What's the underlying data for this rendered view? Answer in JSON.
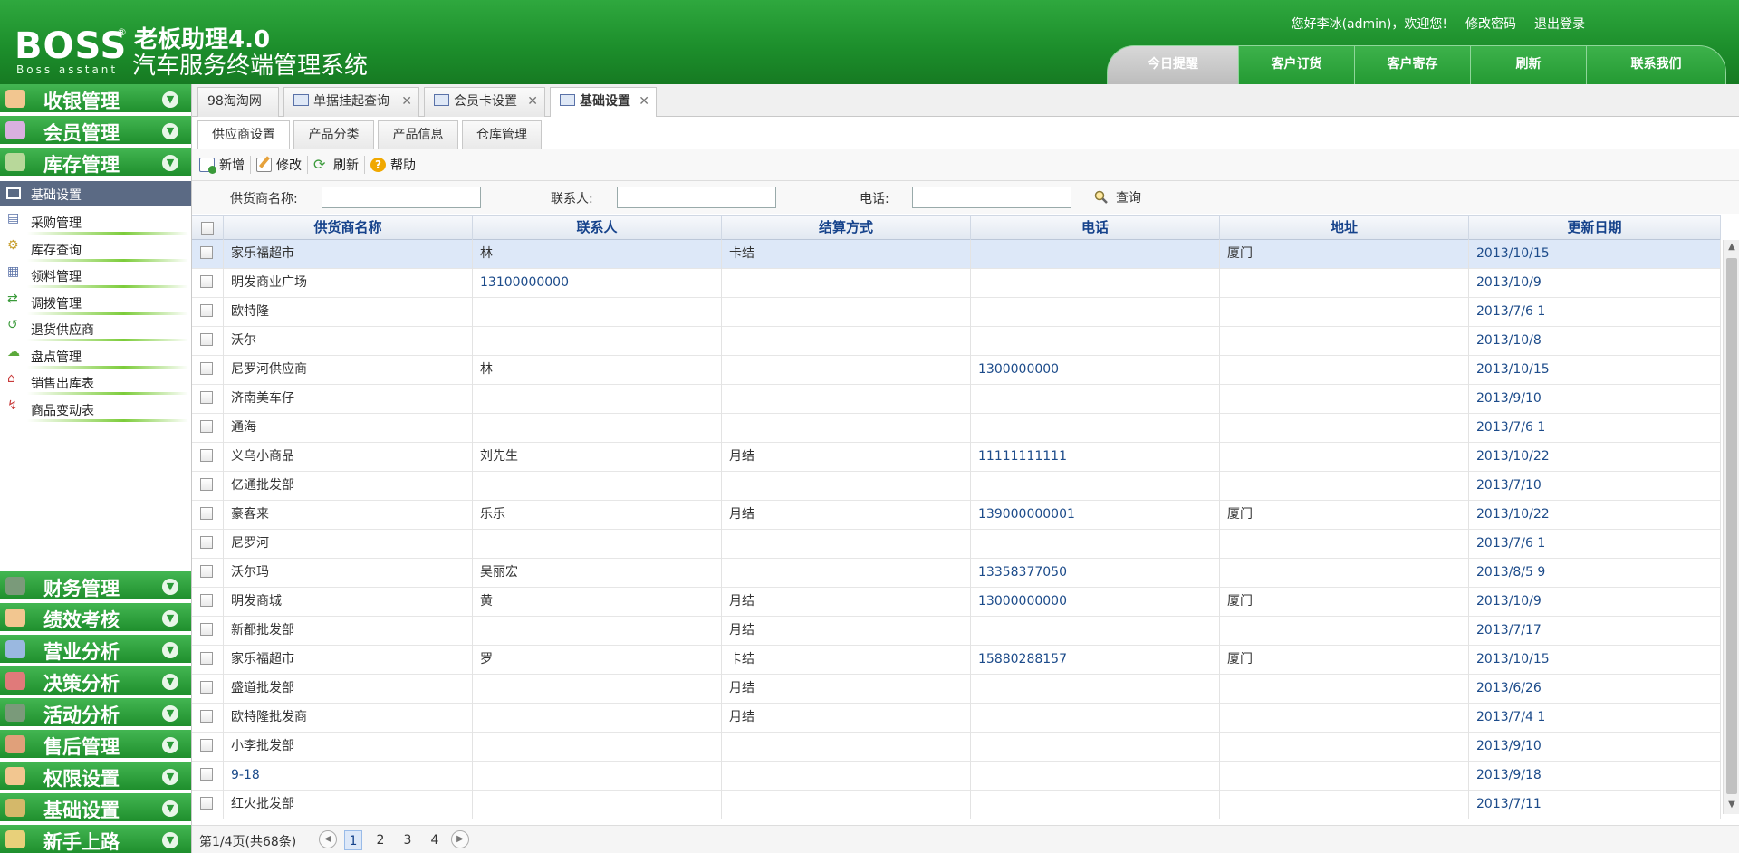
{
  "header": {
    "logo_text": "BOSS",
    "logo_reg": "®",
    "logo_sub": "Boss asstant",
    "title_line1": "老板助理4.0",
    "title_line2": "汽车服务终端管理系统",
    "greeting": "您好李冰(admin)，欢迎您!",
    "change_password": "修改密码",
    "logout": "退出登录",
    "nav": [
      "今日提醒",
      "客户订货",
      "客户寄存",
      "刷新",
      "联系我们"
    ]
  },
  "sidebar": {
    "top_menus": [
      {
        "label": "收银管理",
        "icon": "cashier-icon"
      },
      {
        "label": "会员管理",
        "icon": "member-icon"
      },
      {
        "label": "库存管理",
        "icon": "inventory-icon"
      }
    ],
    "active_sub": "基础设置",
    "sub_items": [
      {
        "label": "采购管理",
        "icon": "purchase-icon",
        "glyph": "▤"
      },
      {
        "label": "库存查询",
        "icon": "inventory-query-icon",
        "glyph": "⚙"
      },
      {
        "label": "领料管理",
        "icon": "requisition-icon",
        "glyph": "▦"
      },
      {
        "label": "调拨管理",
        "icon": "transfer-icon",
        "glyph": "⇄"
      },
      {
        "label": "退货供应商",
        "icon": "return-icon",
        "glyph": "↺"
      },
      {
        "label": "盘点管理",
        "icon": "stocktake-icon",
        "glyph": "☁"
      },
      {
        "label": "销售出库表",
        "icon": "sales-out-icon",
        "glyph": "⌂"
      },
      {
        "label": "商品变动表",
        "icon": "product-change-icon",
        "glyph": "↯"
      }
    ],
    "bottom_menus": [
      {
        "label": "财务管理",
        "icon": "finance-icon"
      },
      {
        "label": "绩效考核",
        "icon": "performance-icon"
      },
      {
        "label": "营业分析",
        "icon": "business-analysis-icon"
      },
      {
        "label": "决策分析",
        "icon": "decision-analysis-icon"
      },
      {
        "label": "活动分析",
        "icon": "activity-analysis-icon"
      },
      {
        "label": "售后管理",
        "icon": "after-sales-icon"
      },
      {
        "label": "权限设置",
        "icon": "permission-icon"
      },
      {
        "label": "基础设置",
        "icon": "basic-settings-icon"
      },
      {
        "label": "新手上路",
        "icon": "beginner-icon"
      }
    ]
  },
  "tabs": [
    {
      "label": "98淘淘网",
      "has_icon": false,
      "closable": false
    },
    {
      "label": "单据挂起查询",
      "has_icon": true,
      "closable": true
    },
    {
      "label": "会员卡设置",
      "has_icon": true,
      "closable": true
    },
    {
      "label": "基础设置",
      "has_icon": true,
      "closable": true,
      "active": true
    }
  ],
  "subtabs": [
    "供应商设置",
    "产品分类",
    "产品信息",
    "仓库管理"
  ],
  "toolbar": {
    "add": "新增",
    "edit": "修改",
    "refresh": "刷新",
    "help": "帮助"
  },
  "search": {
    "supplier_label": "供货商名称:",
    "contact_label": "联系人:",
    "phone_label": "电话:",
    "query": "查询",
    "supplier_value": "",
    "contact_value": "",
    "phone_value": ""
  },
  "grid": {
    "columns": [
      "供货商名称",
      "联系人",
      "结算方式",
      "电话",
      "地址",
      "更新日期"
    ],
    "rows": [
      [
        "家乐福超市",
        "林",
        "卡结",
        "",
        "厦门",
        "2013/10/15"
      ],
      [
        "明发商业广场",
        "13100000000",
        "",
        "",
        "",
        "2013/10/9"
      ],
      [
        "欧特隆",
        "",
        "",
        "",
        "",
        "2013/7/6 1"
      ],
      [
        "沃尔",
        "",
        "",
        "",
        "",
        "2013/10/8"
      ],
      [
        "尼罗河供应商",
        "林",
        "",
        "1300000000",
        "",
        "2013/10/15"
      ],
      [
        "济南美车仔",
        "",
        "",
        "",
        "",
        "2013/9/10"
      ],
      [
        "通海",
        "",
        "",
        "",
        "",
        "2013/7/6 1"
      ],
      [
        "义乌小商品",
        "刘先生",
        "月结",
        "11111111111",
        "",
        "2013/10/22"
      ],
      [
        "亿通批发部",
        "",
        "",
        "",
        "",
        "2013/7/10"
      ],
      [
        "豪客来",
        "乐乐",
        "月结",
        "139000000001",
        "厦门",
        "2013/10/22"
      ],
      [
        "尼罗河",
        "",
        "",
        "",
        "",
        "2013/7/6 1"
      ],
      [
        "沃尔玛",
        "吴丽宏",
        "",
        "13358377050",
        "",
        "2013/8/5 9"
      ],
      [
        "明发商城",
        "黄",
        "月结",
        "13000000000",
        "厦门",
        "2013/10/9"
      ],
      [
        "新都批发部",
        "",
        "月结",
        "",
        "",
        "2013/7/17"
      ],
      [
        "家乐福超市",
        "罗",
        "卡结",
        "15880288157",
        "厦门",
        "2013/10/15"
      ],
      [
        "盛道批发部",
        "",
        "月结",
        "",
        "",
        "2013/6/26"
      ],
      [
        "欧特隆批发商",
        "",
        "月结",
        "",
        "",
        "2013/7/4 1"
      ],
      [
        "小李批发部",
        "",
        "",
        "",
        "",
        "2013/9/10"
      ],
      [
        "9-18",
        "",
        "",
        "",
        "",
        "2013/9/18"
      ],
      [
        "红火批发部",
        "",
        "",
        "",
        "",
        "2013/7/11"
      ]
    ],
    "selected_row": 0
  },
  "pager": {
    "info": "第1/4页(共68条)",
    "pages": [
      "1",
      "2",
      "3",
      "4"
    ],
    "current": "1"
  }
}
